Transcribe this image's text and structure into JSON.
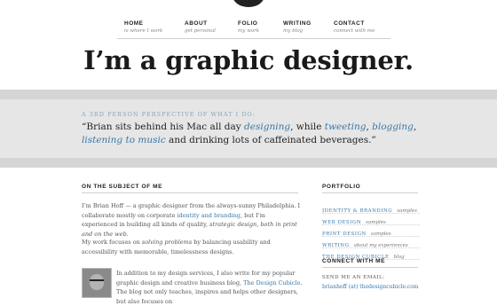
{
  "nav": {
    "items": [
      {
        "label": "HOME",
        "sub": "is where I work"
      },
      {
        "label": "ABOUT",
        "sub": "get personal"
      },
      {
        "label": "FOLIO",
        "sub": "my work"
      },
      {
        "label": "WRITING",
        "sub": "my blog"
      },
      {
        "label": "CONTACT",
        "sub": "connect with me"
      }
    ]
  },
  "headline": "I’m a graphic designer.",
  "intro": {
    "kicker": "A 3rd person perspective of what I do:",
    "quote_1": "“Brian sits behind his Mac all day ",
    "link_designing": "designing",
    "quote_2": ", while ",
    "link_tweeting": "tweeting",
    "quote_3": ", ",
    "link_blogging": "blogging",
    "quote_4": ",",
    "link_music": "listening to music",
    "quote_5": " and drinking lots of caffeinated beverages.”"
  },
  "about": {
    "heading": "On the subject of me",
    "p1_a": "I’m Brian Hoff — a graphic designer from the always-sunny Philadelphia. I collaborate mostly on corporate ",
    "p1_link": "identity and branding",
    "p1_b": ", but I’m experienced in building all kinds of quality, ",
    "p1_em": "strategic design, both in print and on the web",
    "p1_c": ".",
    "p2_a": "My work focuses on ",
    "p2_em": "solving problems",
    "p2_b": " by balancing usability and accessibility with memorable, timelessness designs.",
    "p3_a": "In addition to my design services, I also write for my popular graphic design and creative business blog, ",
    "p3_link": "The Design Cubicle",
    "p3_b": ". The blog not only teaches, inspires and helps other designers, but also focuses on"
  },
  "portfolio": {
    "heading": "Portfolio",
    "items": [
      {
        "main": "Identity & Branding",
        "sub": "samples"
      },
      {
        "main": "Web Design",
        "sub": "samples"
      },
      {
        "main": "Print Design",
        "sub": "samples"
      },
      {
        "main": "Writing",
        "sub": "about my experiences"
      },
      {
        "main": "The Design Cubicle",
        "sub": "blog"
      }
    ]
  },
  "connect": {
    "heading": "Connect with me",
    "email_label": "SEND ME AN EMAIL:",
    "email": "brianhoff (at) thedesigncubicle.com"
  },
  "colors": {
    "link": "#3a78a8",
    "band": "#e6e6e6",
    "band_edge": "#d5d5d5",
    "kicker": "#8aa6ba"
  }
}
